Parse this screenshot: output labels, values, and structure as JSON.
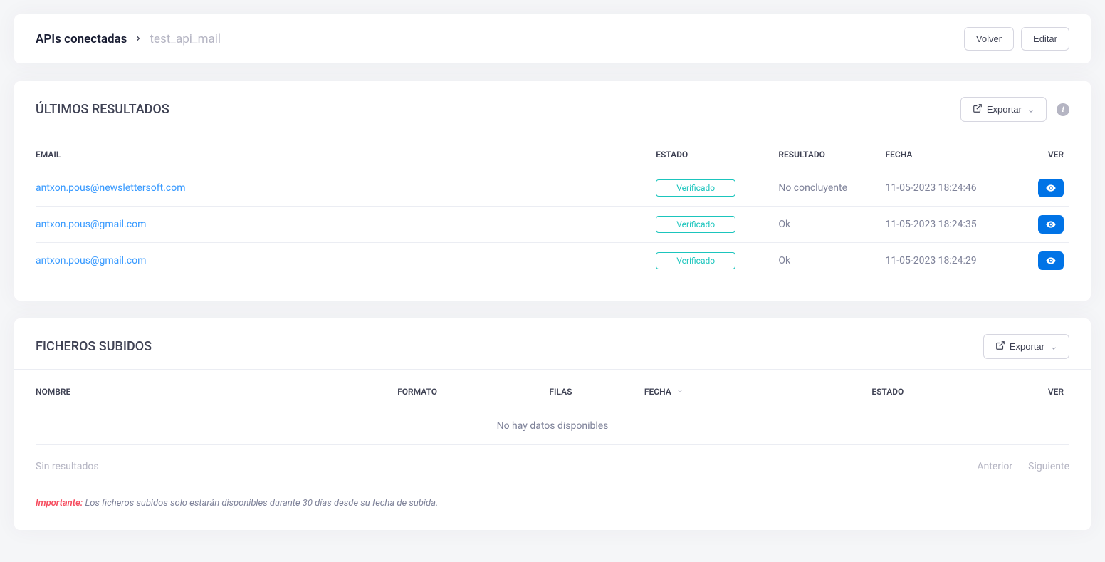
{
  "breadcrumb": {
    "root": "APIs conectadas",
    "current": "test_api_mail"
  },
  "actions": {
    "back": "Volver",
    "edit": "Editar",
    "export": "Exportar"
  },
  "results": {
    "title": "ÚLTIMOS RESULTADOS",
    "columns": {
      "email": "EMAIL",
      "status": "ESTADO",
      "result": "RESULTADO",
      "date": "FECHA",
      "view": "VER"
    },
    "rows": [
      {
        "email": "antxon.pous@newslettersoft.com",
        "status": "Verificado",
        "result": "No concluyente",
        "date": "11-05-2023 18:24:46"
      },
      {
        "email": "antxon.pous@gmail.com",
        "status": "Verificado",
        "result": "Ok",
        "date": "11-05-2023 18:24:35"
      },
      {
        "email": "antxon.pous@gmail.com",
        "status": "Verificado",
        "result": "Ok",
        "date": "11-05-2023 18:24:29"
      }
    ]
  },
  "files": {
    "title": "FICHEROS SUBIDOS",
    "columns": {
      "name": "NOMBRE",
      "format": "FORMATO",
      "rows": "FILAS",
      "date": "FECHA",
      "status": "ESTADO",
      "view": "VER"
    },
    "empty": "No hay datos disponibles",
    "no_results": "Sin resultados",
    "prev": "Anterior",
    "next": "Siguiente",
    "important_label": "Importante:",
    "important_text": "Los ficheros subidos solo estarán disponibles durante 30 días desde su fecha de subida."
  }
}
